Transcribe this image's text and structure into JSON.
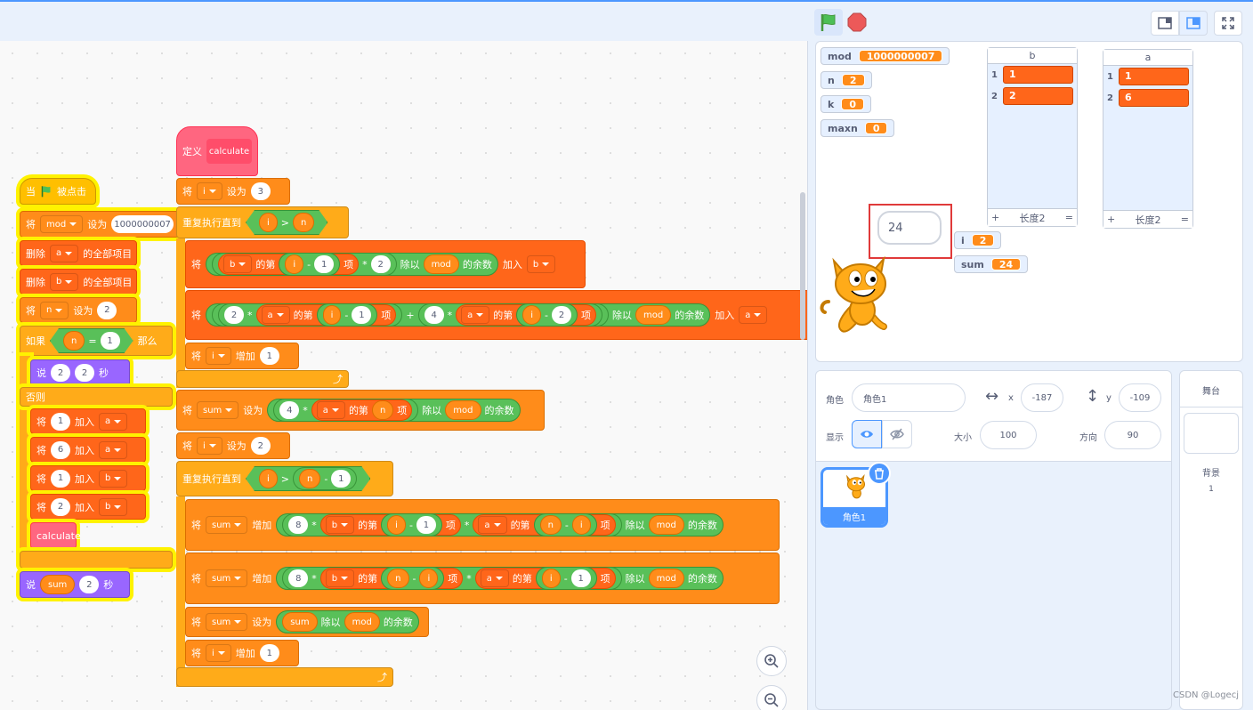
{
  "colors": {
    "accent": "#4c97ff",
    "events": "#ffbf00",
    "variables": "#ff8c1a",
    "lists": "#ff661a",
    "control": "#ffab19",
    "looks": "#9966ff",
    "myblocks": "#ff6680",
    "operators": "#59c059",
    "highlight": "#fff200",
    "callout": "#e03a3a"
  },
  "icons": {
    "green_flag": "green-flag-icon",
    "stop": "stop-icon",
    "small_stage": "small-stage-icon",
    "normal_stage": "normal-stage-icon",
    "fullscreen": "fullscreen-icon",
    "zoom_in": "zoom-in-icon",
    "zoom_out": "zoom-out-icon",
    "show": "eye-icon",
    "hide": "eye-off-icon",
    "delete": "trash-icon"
  },
  "script1": {
    "hat": {
      "when": "当",
      "flag_clicked": "被点击"
    },
    "set_mod": {
      "set": "将",
      "var": "mod",
      "to": "设为",
      "value": "1000000007"
    },
    "del_a": {
      "delete": "删除",
      "list": "a",
      "all": "的全部项目"
    },
    "del_b": {
      "delete": "删除",
      "list": "b",
      "all": "的全部项目"
    },
    "set_n": {
      "set": "将",
      "var": "n",
      "to": "设为",
      "value": "2"
    },
    "if": {
      "if": "如果",
      "var": "n",
      "eq": "=",
      "value": "1",
      "then": "那么"
    },
    "say_in_if": {
      "say": "说",
      "a": "2",
      "b": "2",
      "secs": "秒"
    },
    "else": "否则",
    "add1": {
      "op": "将",
      "value": "1",
      "add": "加入",
      "list": "a"
    },
    "add2": {
      "op": "将",
      "value": "6",
      "add": "加入",
      "list": "a"
    },
    "add3": {
      "op": "将",
      "value": "1",
      "add": "加入",
      "list": "b"
    },
    "add4": {
      "op": "将",
      "value": "2",
      "add": "加入",
      "list": "b"
    },
    "call": "calculate",
    "say_end": {
      "say": "说",
      "var": "sum",
      "value": "2",
      "secs": "秒"
    }
  },
  "script2": {
    "define": {
      "define": "定义",
      "name": "calculate"
    },
    "set_i3": {
      "set": "将",
      "var": "i",
      "to": "设为",
      "value": "3"
    },
    "repeat1": {
      "label": "重复执行直到",
      "var": "i",
      "gt": ">",
      "var2": "n"
    },
    "l1": {
      "set": "将",
      "list": "b",
      "of": "的第",
      "idx": "i",
      "minus": "-",
      "one": "1",
      "item": "项",
      "times": "*",
      "two": "2",
      "mod_label": "除以",
      "mod": "mod",
      "rem": "的余数",
      "add": "加入",
      "target": "b"
    },
    "l2": {
      "set": "将",
      "two": "2",
      "times": "*",
      "list": "a",
      "of": "的第",
      "idx": "i",
      "minus": "-",
      "one": "1",
      "item": "项",
      "plus": "+",
      "four": "4",
      "times2": "*",
      "list2": "a",
      "of2": "的第",
      "idx2": "i",
      "minus2": "-",
      "two2": "2",
      "item2": "项",
      "mod_label": "除以",
      "mod": "mod",
      "rem": "的余数",
      "add": "加入",
      "target": "a"
    },
    "inc_i": {
      "set": "将",
      "var": "i",
      "change": "增加",
      "value": "1"
    },
    "set_sum": {
      "set": "将",
      "var": "sum",
      "to": "设为",
      "four": "4",
      "times": "*",
      "list": "a",
      "of": "的第",
      "idx": "n",
      "item": "项",
      "mod_label": "除以",
      "mod": "mod",
      "rem": "的余数"
    },
    "set_i2": {
      "set": "将",
      "var": "i",
      "to": "设为",
      "value": "2"
    },
    "repeat2": {
      "label": "重复执行直到",
      "var": "i",
      "gt": ">",
      "var2": "n",
      "minus": "-",
      "one": "1"
    },
    "s1": {
      "set": "将",
      "var": "sum",
      "change": "增加",
      "eight": "8",
      "times": "*",
      "list": "b",
      "of": "的第",
      "idx": "i",
      "minus": "-",
      "one": "1",
      "item": "项",
      "times2": "*",
      "list2": "a",
      "of2": "的第",
      "n": "n",
      "minus2": "-",
      "i": "i",
      "item2": "项",
      "mod_label": "除以",
      "mod": "mod",
      "rem": "的余数"
    },
    "s2": {
      "set": "将",
      "var": "sum",
      "change": "增加",
      "eight": "8",
      "times": "*",
      "list": "b",
      "of": "的第",
      "n": "n",
      "minus": "-",
      "i": "i",
      "item": "项",
      "times2": "*",
      "list2": "a",
      "of2": "的第",
      "idx": "i",
      "minus2": "-",
      "one": "1",
      "item2": "项",
      "mod_label": "除以",
      "mod": "mod",
      "rem": "的余数"
    },
    "s3": {
      "set": "将",
      "var": "sum",
      "to": "设为",
      "sum": "sum",
      "mod_label": "除以",
      "mod": "mod",
      "rem": "的余数"
    },
    "inc_i2": {
      "set": "将",
      "var": "i",
      "change": "增加",
      "value": "1"
    }
  },
  "stage": {
    "monitors": [
      {
        "name": "mod",
        "value": "1000000007"
      },
      {
        "name": "n",
        "value": "2"
      },
      {
        "name": "k",
        "value": "0"
      },
      {
        "name": "maxn",
        "value": "0"
      },
      {
        "name": "i",
        "value": "2"
      },
      {
        "name": "sum",
        "value": "24"
      }
    ],
    "list_b": {
      "title": "b",
      "items": [
        {
          "idx": "1",
          "val": "1"
        },
        {
          "idx": "2",
          "val": "2"
        }
      ],
      "add": "+",
      "length": "长度2",
      "resize": "="
    },
    "list_a": {
      "title": "a",
      "items": [
        {
          "idx": "1",
          "val": "1"
        },
        {
          "idx": "2",
          "val": "6"
        }
      ],
      "add": "+",
      "length": "长度2",
      "resize": "="
    },
    "speech": "24"
  },
  "sprite_info": {
    "sprite_label": "角色",
    "sprite_name": "角色1",
    "x_label": "x",
    "x_value": "-187",
    "y_label": "y",
    "y_value": "-109",
    "show_label": "显示",
    "size_label": "大小",
    "size_value": "100",
    "direction_label": "方向",
    "direction_value": "90"
  },
  "sprite_list": [
    {
      "name": "角色1"
    }
  ],
  "backdrop": {
    "tab": "舞台",
    "label": "背景",
    "count": "1"
  },
  "watermark": "CSDN @Logecj"
}
